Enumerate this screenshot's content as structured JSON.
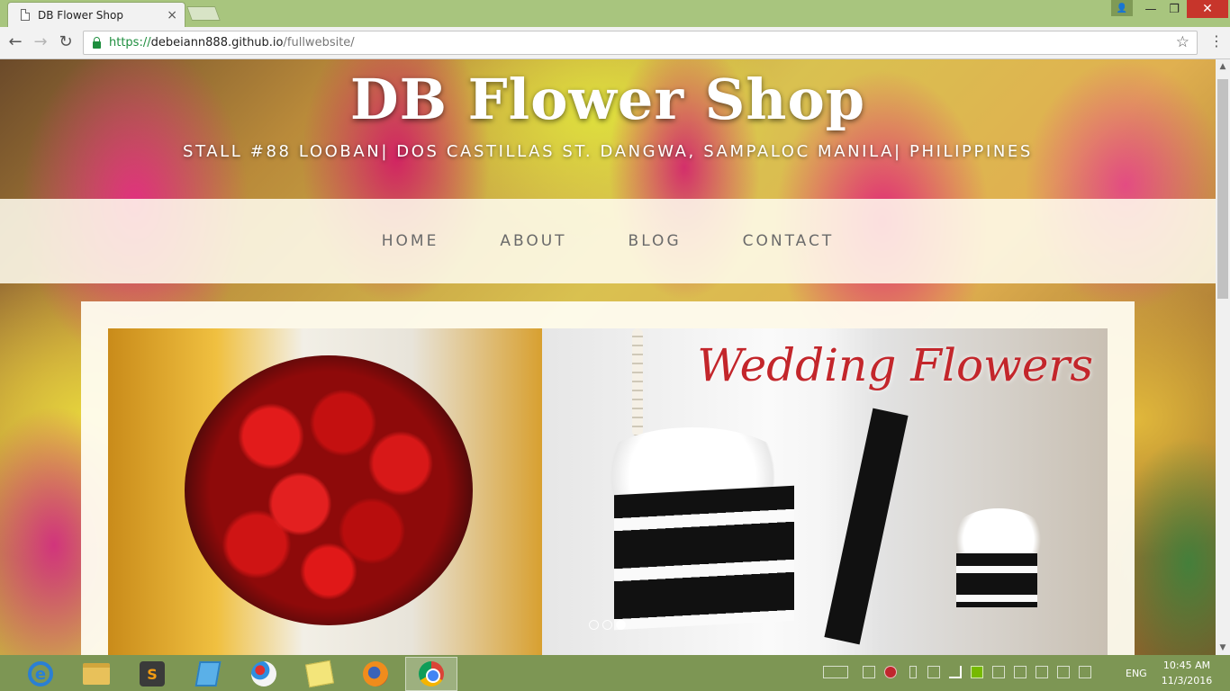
{
  "browser": {
    "tab_title": "DB Flower Shop",
    "tab_close": "×",
    "url_secure": "https://",
    "url_host": "debeiann888.github.io",
    "url_path": "/fullwebsite/",
    "back_icon": "←",
    "forward_icon": "→",
    "reload_icon": "↻",
    "star_icon": "☆",
    "menu_icon": "⋮",
    "user_icon": "👤",
    "minimize_icon": "—",
    "maximize_icon": "❐",
    "close_icon": "✕"
  },
  "site": {
    "title": "DB Flower Shop",
    "address": "STALL #88 LOOBAN| DOS CASTILLAS ST. DANGWA, SAMPALOC MANILA| PHILIPPINES",
    "nav": [
      {
        "label": "HOME"
      },
      {
        "label": "ABOUT"
      },
      {
        "label": "BLOG"
      },
      {
        "label": "CONTACT"
      }
    ],
    "slider": {
      "caption": "Wedding Flowers",
      "slide_count": 3,
      "active_slide": 3
    }
  },
  "scrollbar": {
    "up_icon": "▲",
    "down_icon": "▼"
  },
  "taskbar": {
    "apps": [
      {
        "name": "internet-explorer",
        "glyph": "e"
      },
      {
        "name": "file-explorer"
      },
      {
        "name": "sublime-text",
        "glyph": "S"
      },
      {
        "name": "notepad"
      },
      {
        "name": "paint"
      },
      {
        "name": "sticky-notes"
      },
      {
        "name": "firefox"
      },
      {
        "name": "chrome"
      }
    ],
    "language": "ENG",
    "time": "10:45 AM",
    "date": "11/3/2016"
  },
  "colors": {
    "chrome_frame": "#a8c57e",
    "taskbar": "#7d9654",
    "secure_green": "#1e8e3e",
    "caption_red": "#c3262b"
  }
}
